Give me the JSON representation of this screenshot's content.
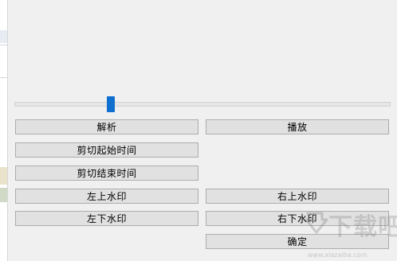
{
  "slider": {
    "position_fraction": 0.25
  },
  "buttons": {
    "parse": "解析",
    "play": "播放",
    "cut_start": "剪切起始时间",
    "cut_end": "剪切结束时间",
    "top_left_watermark": "左上水印",
    "top_right_watermark": "右上水印",
    "bottom_left_watermark": "左下水印",
    "bottom_right_watermark": "右下水印",
    "confirm": "确定"
  },
  "watermark": {
    "brand": "下载吧",
    "url": "www.xiazaiba.com"
  },
  "colors": {
    "background": "#f0f0f0",
    "button_face": "#e1e1e1",
    "button_border": "#adadad",
    "slider_thumb": "#0f6fcf"
  }
}
